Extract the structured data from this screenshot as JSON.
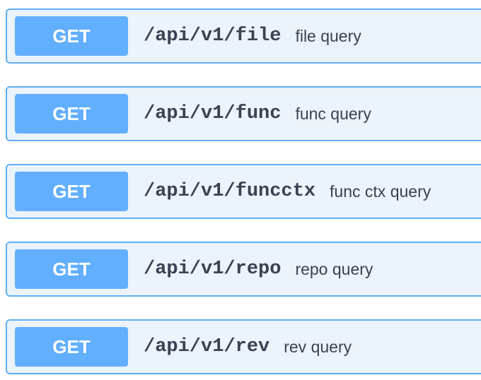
{
  "endpoints": [
    {
      "method": "GET",
      "path": "/api/v1/file",
      "summary": "file query"
    },
    {
      "method": "GET",
      "path": "/api/v1/func",
      "summary": "func query"
    },
    {
      "method": "GET",
      "path": "/api/v1/funcctx",
      "summary": "func ctx query"
    },
    {
      "method": "GET",
      "path": "/api/v1/repo",
      "summary": "repo query"
    },
    {
      "method": "GET",
      "path": "/api/v1/rev",
      "summary": "rev query"
    }
  ],
  "colors": {
    "get_accent": "#61affe",
    "get_background": "#ebf3fb",
    "text": "#3b4151"
  }
}
